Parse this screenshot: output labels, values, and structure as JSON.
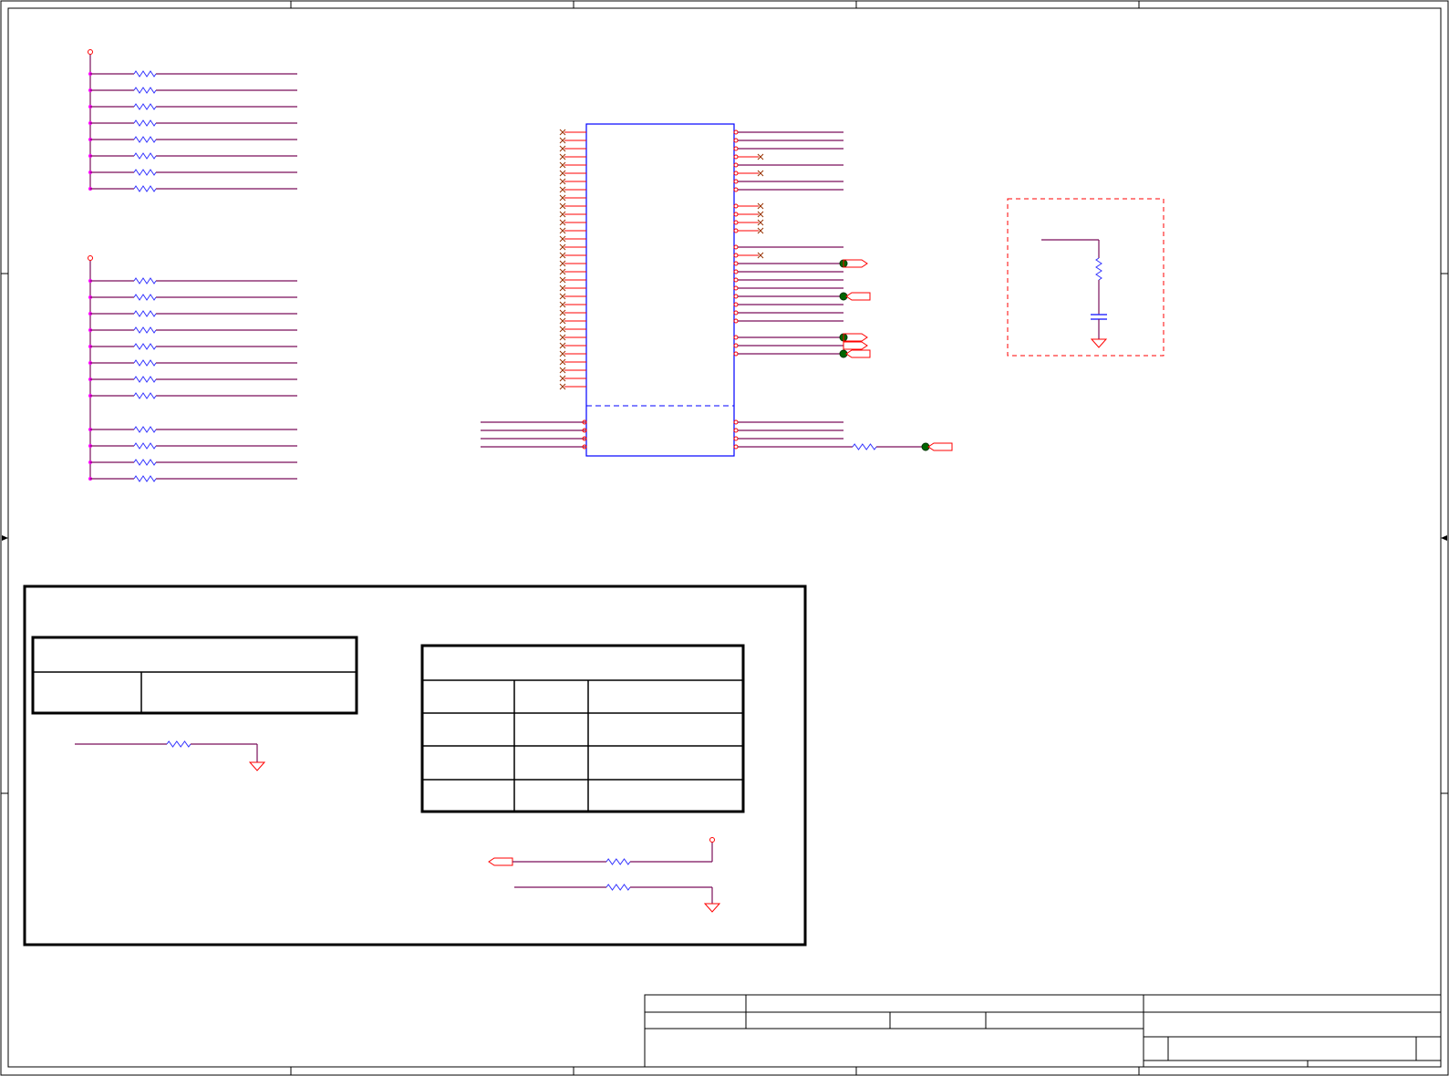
{
  "sheet": {
    "title": "",
    "frame_color": "#000000"
  },
  "colors": {
    "wire": "#7a0f5a",
    "pin": "#ff0000",
    "resistor": "#3333ff",
    "power_dot": "#ff00ff",
    "component_body": "#0000ff",
    "junction": "#006600",
    "no_connect": "#993300",
    "dashed_box": "#ff0000",
    "table_line": "#000000"
  },
  "schematic": {
    "pullup_bank_1": {
      "resistor_count": 8
    },
    "pullup_bank_2": {
      "resistor_count": 12
    },
    "ic": {
      "left_pins": 32,
      "right_pins": 27
    },
    "strap_table_left": {
      "rows": 2
    },
    "strap_table_right": {
      "rows": 5
    },
    "title_block": {
      "label": ""
    }
  },
  "icons": [
    "resistor-icon",
    "ground-icon",
    "power-rail-icon",
    "no-connect-icon",
    "offpage-connector-icon",
    "capacitor-icon",
    "junction-dot-icon"
  ]
}
